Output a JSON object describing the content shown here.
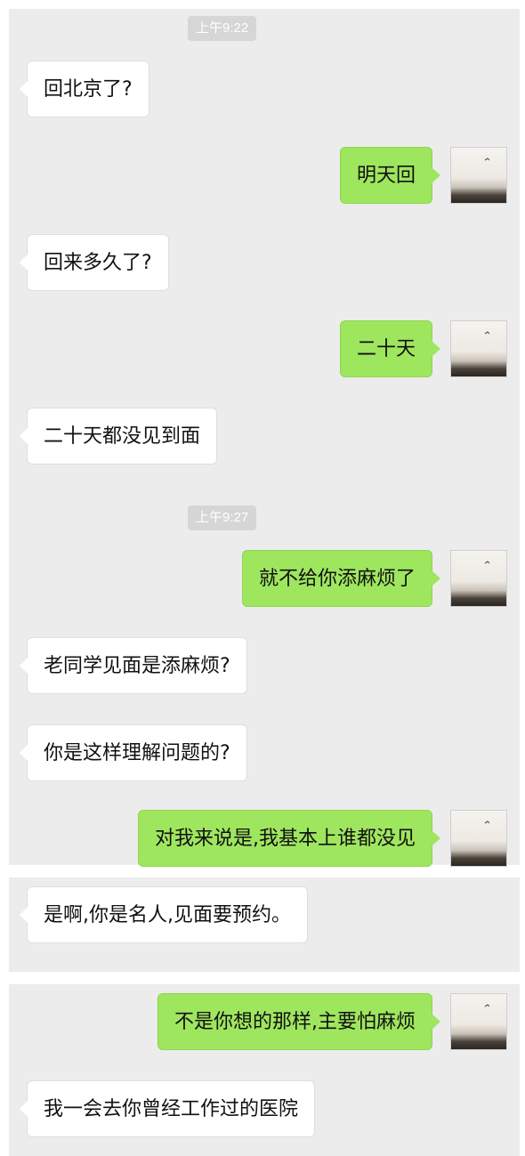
{
  "timestamps": [
    "上午9:22",
    "上午9:27"
  ],
  "messages": [
    {
      "dir": "in",
      "text": "回北京了?"
    },
    {
      "dir": "out",
      "text": "明天回"
    },
    {
      "dir": "in",
      "text": "回来多久了?"
    },
    {
      "dir": "out",
      "text": "二十天"
    },
    {
      "dir": "in",
      "text": "二十天都没见到面"
    },
    {
      "dir": "out",
      "text": "就不给你添麻烦了"
    },
    {
      "dir": "in",
      "text": "老同学见面是添麻烦?"
    },
    {
      "dir": "in",
      "text": "你是这样理解问题的?"
    },
    {
      "dir": "out",
      "text": "对我来说是,我基本上谁都没见"
    },
    {
      "dir": "in",
      "text": "是啊,你是名人,见面要预约。"
    },
    {
      "dir": "out",
      "text": "不是你想的那样,主要怕麻烦"
    },
    {
      "dir": "in",
      "text": "我一会去你曾经工作过的医院"
    }
  ],
  "colors": {
    "chat_bg": "#ececec",
    "outgoing_bubble": "#9fe65f",
    "incoming_bubble": "#ffffff",
    "timestamp_bg": "#d6d6d6"
  },
  "icons": {
    "avatar": "seaside-landscape-avatar"
  }
}
